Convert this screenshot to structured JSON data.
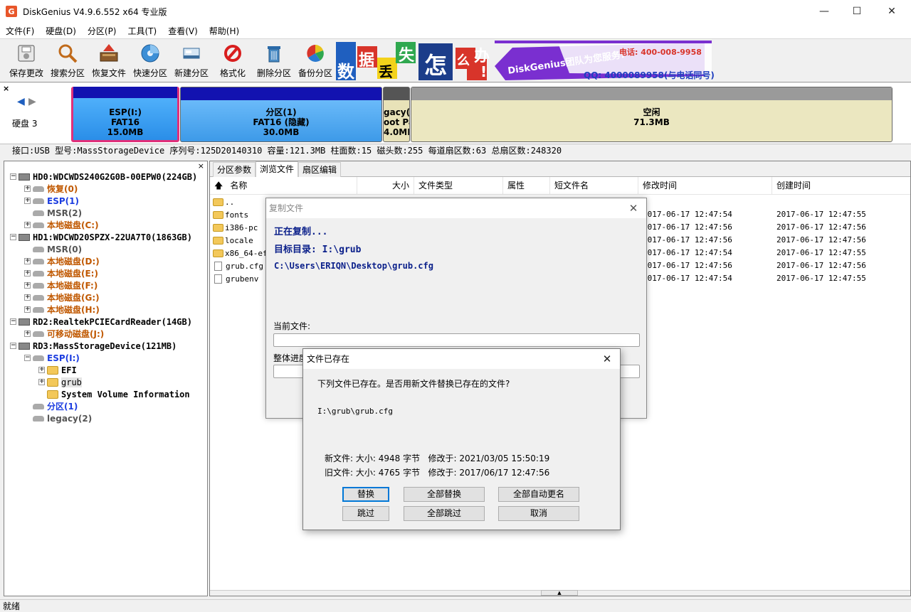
{
  "window": {
    "title": "DiskGenius V4.9.6.552 x64 专业版",
    "app_icon": "G"
  },
  "menu": [
    "文件(F)",
    "硬盘(D)",
    "分区(P)",
    "工具(T)",
    "查看(V)",
    "帮助(H)"
  ],
  "toolbar": [
    {
      "label": "保存更改",
      "icon": "save-icon"
    },
    {
      "label": "搜索分区",
      "icon": "search-icon"
    },
    {
      "label": "恢复文件",
      "icon": "recover-icon"
    },
    {
      "label": "快速分区",
      "icon": "quick-partition-icon"
    },
    {
      "label": "新建分区",
      "icon": "new-partition-icon"
    },
    {
      "label": "格式化",
      "icon": "format-icon"
    },
    {
      "label": "删除分区",
      "icon": "delete-icon"
    },
    {
      "label": "备份分区",
      "icon": "backup-icon"
    }
  ],
  "banner": {
    "chars": [
      "数",
      "据",
      "丢",
      "失",
      "怎",
      "么",
      "办",
      "!"
    ],
    "brand": "DiskGenius团队为您服务!",
    "phone": "电话: 400-008-9958",
    "qq": "QQ: 4000089958(与电话同号)"
  },
  "diskmap": {
    "disk_label": "硬盘 3",
    "partitions": [
      {
        "line1": "ESP(I:)",
        "line2": "FAT16",
        "line3": "15.0MB"
      },
      {
        "line1": "分区(1)",
        "line2": "FAT16 (隐藏)",
        "line3": "30.0MB"
      },
      {
        "line1": "gacy(:",
        "line2": "oot Pa",
        "line3": "4.0ME"
      },
      {
        "line1": "空闲",
        "line2": "71.3MB",
        "line3": ""
      }
    ]
  },
  "diskinfo": "接口:USB  型号:MassStorageDevice  序列号:125D20140310  容量:121.3MB  柱面数:15  磁头数:255  每道扇区数:63  总扇区数:248320",
  "tree": [
    {
      "text": "HD0:WDCWDS240G2G0B-00EPW0(224GB)",
      "color": "black",
      "indent": 0,
      "kind": "disk",
      "pm": "−"
    },
    {
      "text": "恢复(0)",
      "color": "orange",
      "indent": 1,
      "kind": "part",
      "pm": "+"
    },
    {
      "text": "ESP(1)",
      "color": "blue",
      "indent": 1,
      "kind": "part",
      "pm": "+"
    },
    {
      "text": "MSR(2)",
      "color": "gray",
      "indent": 1,
      "kind": "part",
      "pm": ""
    },
    {
      "text": "本地磁盘(C:)",
      "color": "orange",
      "indent": 1,
      "kind": "part",
      "pm": "+"
    },
    {
      "text": "HD1:WDCWD20SPZX-22UA7T0(1863GB)",
      "color": "black",
      "indent": 0,
      "kind": "disk",
      "pm": "−"
    },
    {
      "text": "MSR(0)",
      "color": "gray",
      "indent": 1,
      "kind": "part",
      "pm": ""
    },
    {
      "text": "本地磁盘(D:)",
      "color": "orange",
      "indent": 1,
      "kind": "part",
      "pm": "+"
    },
    {
      "text": "本地磁盘(E:)",
      "color": "orange",
      "indent": 1,
      "kind": "part",
      "pm": "+"
    },
    {
      "text": "本地磁盘(F:)",
      "color": "orange",
      "indent": 1,
      "kind": "part",
      "pm": "+"
    },
    {
      "text": "本地磁盘(G:)",
      "color": "orange",
      "indent": 1,
      "kind": "part",
      "pm": "+"
    },
    {
      "text": "本地磁盘(H:)",
      "color": "orange",
      "indent": 1,
      "kind": "part",
      "pm": "+"
    },
    {
      "text": "RD2:RealtekPCIECardReader(14GB)",
      "color": "black",
      "indent": 0,
      "kind": "disk",
      "pm": "−"
    },
    {
      "text": "可移动磁盘(J:)",
      "color": "orange",
      "indent": 1,
      "kind": "part",
      "pm": "+"
    },
    {
      "text": "RD3:MassStorageDevice(121MB)",
      "color": "black",
      "indent": 0,
      "kind": "disk",
      "pm": "−"
    },
    {
      "text": "ESP(I:)",
      "color": "blue",
      "indent": 1,
      "kind": "part",
      "pm": "−"
    },
    {
      "text": "EFI",
      "color": "black",
      "indent": 2,
      "kind": "folder",
      "pm": "+"
    },
    {
      "text": "grub",
      "color": "black",
      "indent": 2,
      "kind": "folder",
      "pm": "+",
      "selected": true
    },
    {
      "text": "System Volume Information",
      "color": "black",
      "indent": 2,
      "kind": "folder",
      "pm": "",
      "normal": true
    },
    {
      "text": "分区(1)",
      "color": "blue",
      "indent": 1,
      "kind": "part",
      "pm": ""
    },
    {
      "text": "legacy(2)",
      "color": "gray",
      "indent": 1,
      "kind": "part",
      "pm": ""
    }
  ],
  "tabs": [
    "分区参数",
    "浏览文件",
    "扇区编辑"
  ],
  "columns": [
    "名称",
    "大小",
    "文件类型",
    "属性",
    "短文件名",
    "修改时间",
    "创建时间"
  ],
  "files": [
    {
      "name": "..",
      "type": "folder",
      "modified": "",
      "created": ""
    },
    {
      "name": "fonts",
      "type": "folder",
      "modified": "2017-06-17 12:47:54",
      "created": "2017-06-17 12:47:55"
    },
    {
      "name": "i386-pc",
      "type": "folder",
      "modified": "2017-06-17 12:47:56",
      "created": "2017-06-17 12:47:56"
    },
    {
      "name": "locale",
      "type": "folder",
      "modified": "2017-06-17 12:47:56",
      "created": "2017-06-17 12:47:56"
    },
    {
      "name": "x86_64-ef",
      "type": "folder",
      "modified": "2017-06-17 12:47:54",
      "created": "2017-06-17 12:47:55"
    },
    {
      "name": "grub.cfg",
      "type": "file",
      "modified": "2017-06-17 12:47:56",
      "created": "2017-06-17 12:47:56"
    },
    {
      "name": "grubenv",
      "type": "file",
      "modified": "2017-06-17 12:47:54",
      "created": "2017-06-17 12:47:55"
    }
  ],
  "status": "就绪",
  "copy_dialog": {
    "title": "复制文件",
    "copying": "正在复制...",
    "target": "目标目录: I:\\grub",
    "source": "C:\\Users\\ERIQN\\Desktop\\grub.cfg",
    "current_file_label": "当前文件:",
    "overall_label": "整体进度"
  },
  "exists_dialog": {
    "title": "文件已存在",
    "message": "下列文件已存在。是否用新文件替换已存在的文件?",
    "path": "I:\\grub\\grub.cfg",
    "new_file": "新文件: 大小: 4948 字节   修改于: 2021/03/05 15:50:19",
    "old_file": "旧文件: 大小: 4765 字节   修改于: 2017/06/17 12:47:56",
    "buttons": [
      "替换",
      "全部替换",
      "全部自动更名",
      "跳过",
      "全部跳过",
      "取消"
    ]
  }
}
